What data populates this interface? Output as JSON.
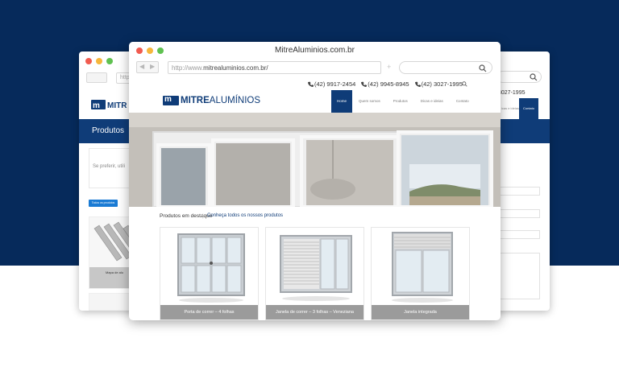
{
  "colors": {
    "background_top": "#062a5b",
    "brand_navy": "#0f3c78",
    "dot_red": "#f15b4f",
    "dot_yellow": "#f6b73c",
    "dot_green": "#5fc150"
  },
  "main_window": {
    "title": "MitreAluminios.com.br",
    "url_prefix": "http://www.",
    "url_host": "mitrealuminios.com.br/",
    "back_glyph": "◀",
    "forward_glyph": "▶",
    "new_tab_glyph": "+",
    "phones": [
      "(42) 9917-2454",
      "(42) 9945-8945",
      "(42) 3027-1995"
    ],
    "logo": {
      "mark": "m",
      "brand_bold": "MITRE",
      "brand_rest": "ALUMÍNIOS"
    },
    "menu": [
      "Home",
      "Quem somos",
      "Produtos",
      "Dicas e ideias",
      "Contato"
    ],
    "active_menu": "Home",
    "featured": {
      "title": "Produtos em destaque",
      "separator": "|",
      "link": "Conheça todos os nossos produtos"
    },
    "products": [
      "Porta de correr – 4 folhas",
      "Janela de correr – 3 folhas – Veneziana",
      "Janela integrada"
    ]
  },
  "left_window": {
    "url_prefix": "http",
    "logo_text": "MITR",
    "section_title": "Produtos",
    "text": "Se preferir, utili",
    "filter_button": "Todos os produtos",
    "product_caption": "Mapa de alu"
  },
  "right_window": {
    "phone": "3027-1995",
    "menu_item": "icas e ideias",
    "contact_button": "Contato"
  },
  "icons": {
    "search": "search-icon",
    "phone": "phone-icon"
  }
}
